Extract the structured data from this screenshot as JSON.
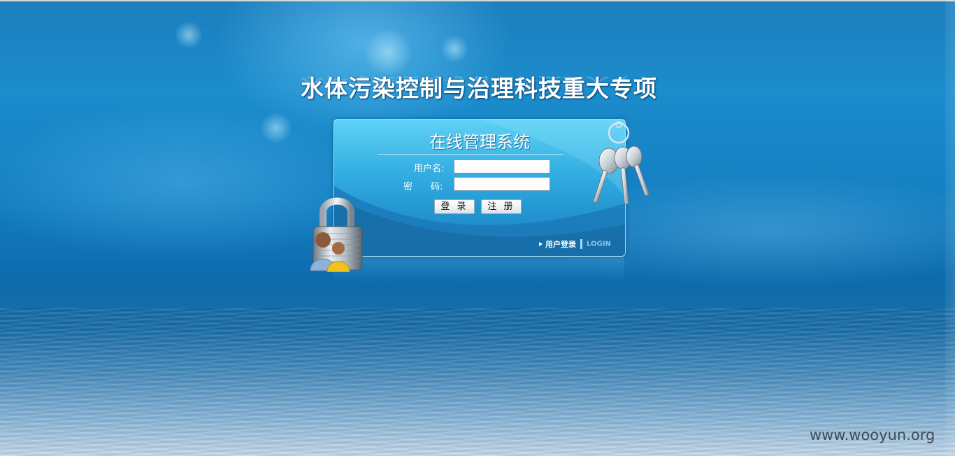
{
  "header": {
    "title": "水体污染控制与治理科技重大专项"
  },
  "login": {
    "panel_title": "在线管理系统",
    "username_label": "用户名:",
    "password_label": "密　　码:",
    "username_value": "",
    "password_value": "",
    "login_button": "登 录",
    "register_button": "注 册",
    "footer_user_login": "用户登录",
    "footer_login_en": "LOGIN"
  },
  "watermark": "www.wooyun.org",
  "icons": [
    "lock-icon",
    "users-icon",
    "keys-icon",
    "arrow-icon"
  ],
  "colors": {
    "background_top": "#1d7fbd",
    "panel_light": "#5fd1f5",
    "panel_dark": "#1c7fc0",
    "button_bg": "#f1f3f5",
    "watermark": "#3b4b58"
  }
}
